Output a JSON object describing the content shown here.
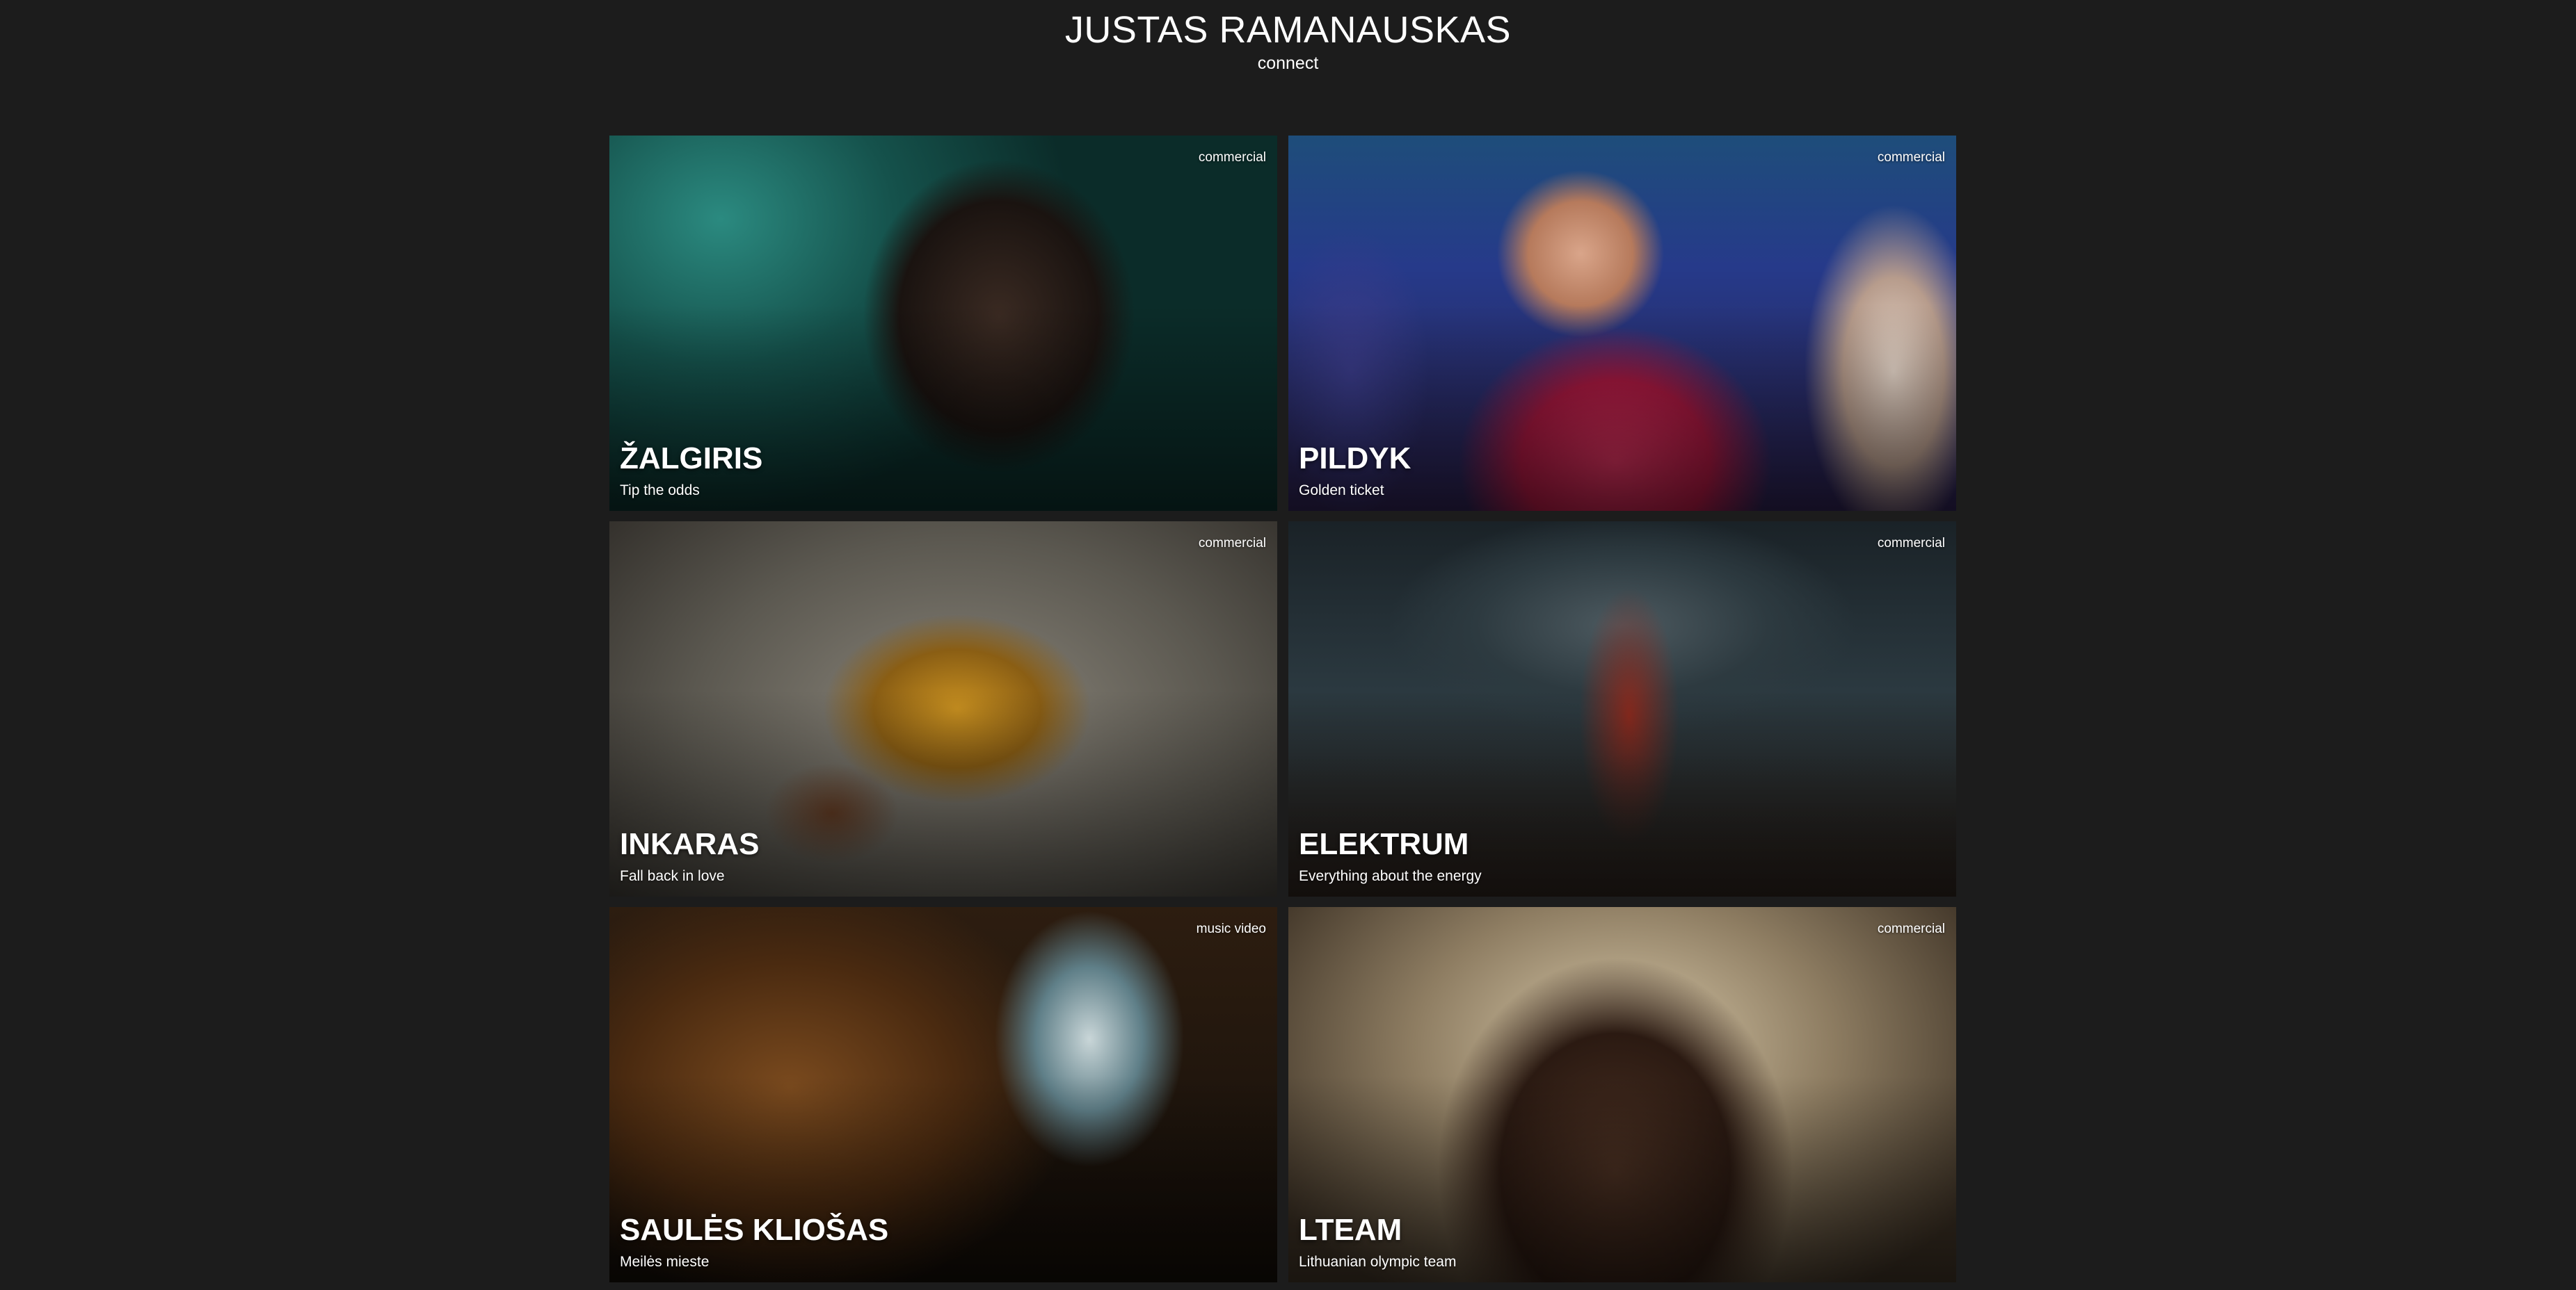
{
  "header": {
    "name": "JUSTAS RAMANAUSKAS",
    "connect_label": "connect"
  },
  "projects": [
    {
      "category": "commercial",
      "title": "ŽALGIRIS",
      "subtitle": "Tip the odds"
    },
    {
      "category": "commercial",
      "title": "PILDYK",
      "subtitle": "Golden ticket"
    },
    {
      "category": "commercial",
      "title": "INKARAS",
      "subtitle": "Fall back in love"
    },
    {
      "category": "commercial",
      "title": "ELEKTRUM",
      "subtitle": "Everything about the energy"
    },
    {
      "category": "music video",
      "title": "SAULĖS KLIOŠAS",
      "subtitle": "Meilės mieste"
    },
    {
      "category": "commercial",
      "title": "LTEAM",
      "subtitle": "Lithuanian olympic team"
    }
  ],
  "colors": {
    "background": "#1c1c1c",
    "text": "#ffffff"
  }
}
